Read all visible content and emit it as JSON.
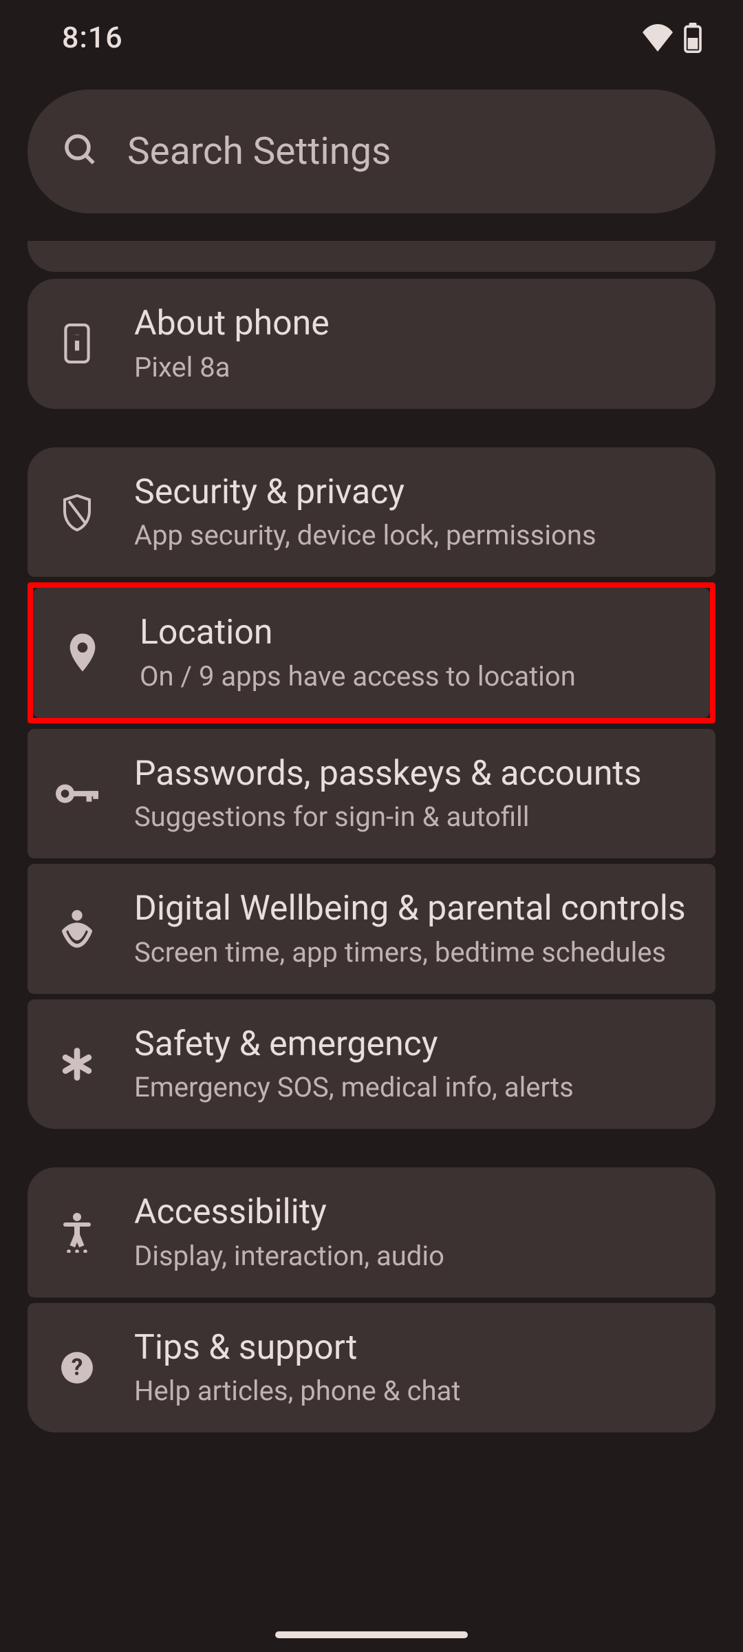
{
  "status": {
    "time": "8:16"
  },
  "search": {
    "placeholder": "Search Settings"
  },
  "items": {
    "about": {
      "title": "About phone",
      "subtitle": "Pixel 8a"
    },
    "security": {
      "title": "Security & privacy",
      "subtitle": "App security, device lock, permissions"
    },
    "location": {
      "title": "Location",
      "subtitle": "On / 9 apps have access to location"
    },
    "passwords": {
      "title": "Passwords, passkeys & accounts",
      "subtitle": "Suggestions for sign-in & autofill"
    },
    "wellbeing": {
      "title": "Digital Wellbeing & parental controls",
      "subtitle": "Screen time, app timers, bedtime schedules"
    },
    "safety": {
      "title": "Safety & emergency",
      "subtitle": "Emergency SOS, medical info, alerts"
    },
    "accessibility": {
      "title": "Accessibility",
      "subtitle": "Display, interaction, audio"
    },
    "tips": {
      "title": "Tips & support",
      "subtitle": "Help articles, phone & chat"
    }
  },
  "highlighted": "location"
}
